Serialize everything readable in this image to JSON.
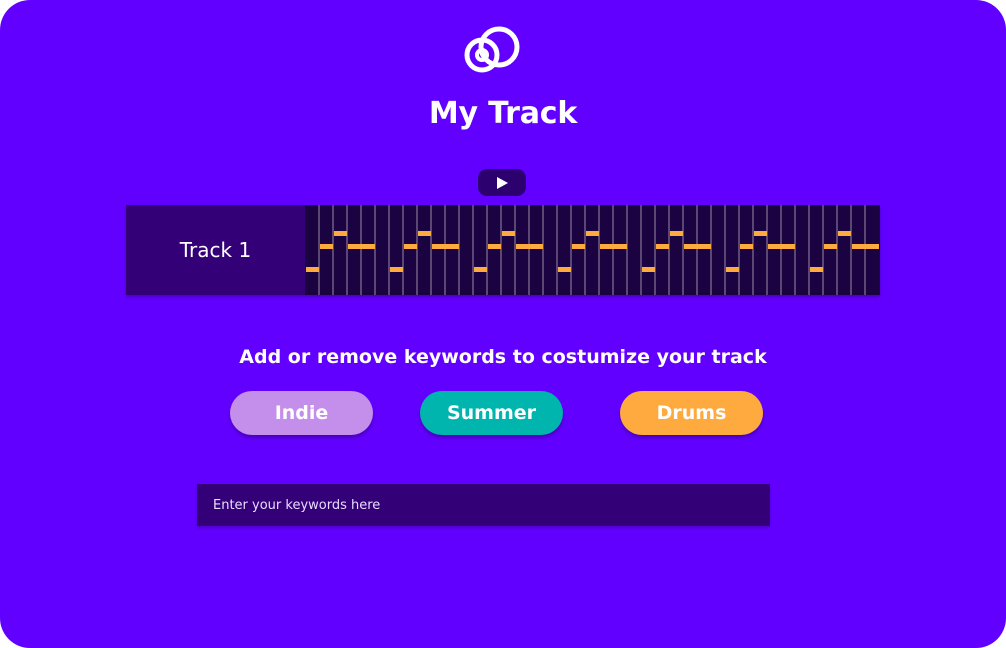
{
  "app": {
    "logo_icon": "linked-circles-logo-icon",
    "title": "My Track",
    "play_icon": "play-icon",
    "colors": {
      "background": "#6200FF",
      "panel": "#330078",
      "grid": "#1B0240",
      "note": "#FFAA3F"
    }
  },
  "track": {
    "label": "Track 1"
  },
  "keywords": {
    "prompt": "Add or remove keywords to costumize your track",
    "tags": [
      {
        "label": "Indie",
        "color": "#C48FEA"
      },
      {
        "label": "Summer",
        "color": "#00B5AD"
      },
      {
        "label": "Drums",
        "color": "#FFAA3F"
      }
    ],
    "input_placeholder": "Enter your keywords here",
    "input_value": ""
  }
}
